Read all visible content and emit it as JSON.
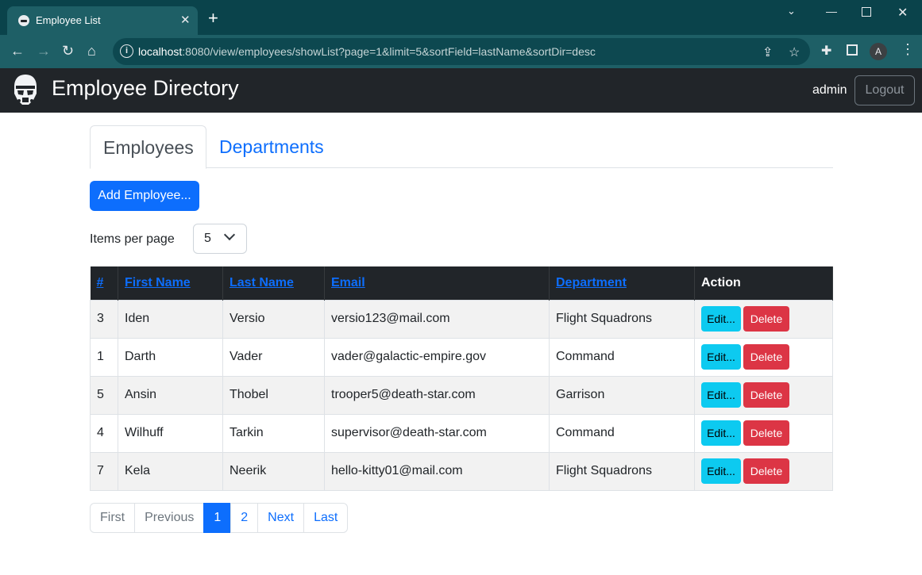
{
  "browser": {
    "tab_title": "Employee List",
    "url_host": "localhost",
    "url_rest": ":8080/view/employees/showList?page=1&limit=5&sortField=lastName&sortDir=desc",
    "profile_initial": "A"
  },
  "navbar": {
    "brand": "Employee Directory",
    "username": "admin",
    "logout_label": "Logout"
  },
  "tabs": [
    {
      "label": "Employees",
      "active": true
    },
    {
      "label": "Departments",
      "active": false
    }
  ],
  "add_button_label": "Add Employee...",
  "items_per_page": {
    "label": "Items per page",
    "selected": "5"
  },
  "table": {
    "headers": [
      "#",
      "First Name",
      "Last Name",
      "Email",
      "Department",
      "Action"
    ],
    "rows": [
      {
        "id": "3",
        "first_name": "Iden",
        "last_name": "Versio",
        "email": "versio123@mail.com",
        "department": "Flight Squadrons"
      },
      {
        "id": "1",
        "first_name": "Darth",
        "last_name": "Vader",
        "email": "vader@galactic-empire.gov",
        "department": "Command"
      },
      {
        "id": "5",
        "first_name": "Ansin",
        "last_name": "Thobel",
        "email": "trooper5@death-star.com",
        "department": "Garrison"
      },
      {
        "id": "4",
        "first_name": "Wilhuff",
        "last_name": "Tarkin",
        "email": "supervisor@death-star.com",
        "department": "Command"
      },
      {
        "id": "7",
        "first_name": "Kela",
        "last_name": "Neerik",
        "email": "hello-kitty01@mail.com",
        "department": "Flight Squadrons"
      }
    ],
    "edit_label": "Edit...",
    "delete_label": "Delete"
  },
  "pagination": {
    "first": "First",
    "previous": "Previous",
    "pages": [
      "1",
      "2"
    ],
    "current": "1",
    "next": "Next",
    "last": "Last"
  },
  "colors": {
    "primary": "#0d6efd",
    "info": "#0dcaf0",
    "danger": "#dc3545",
    "dark": "#212529",
    "chrome": "#1e5f66"
  }
}
